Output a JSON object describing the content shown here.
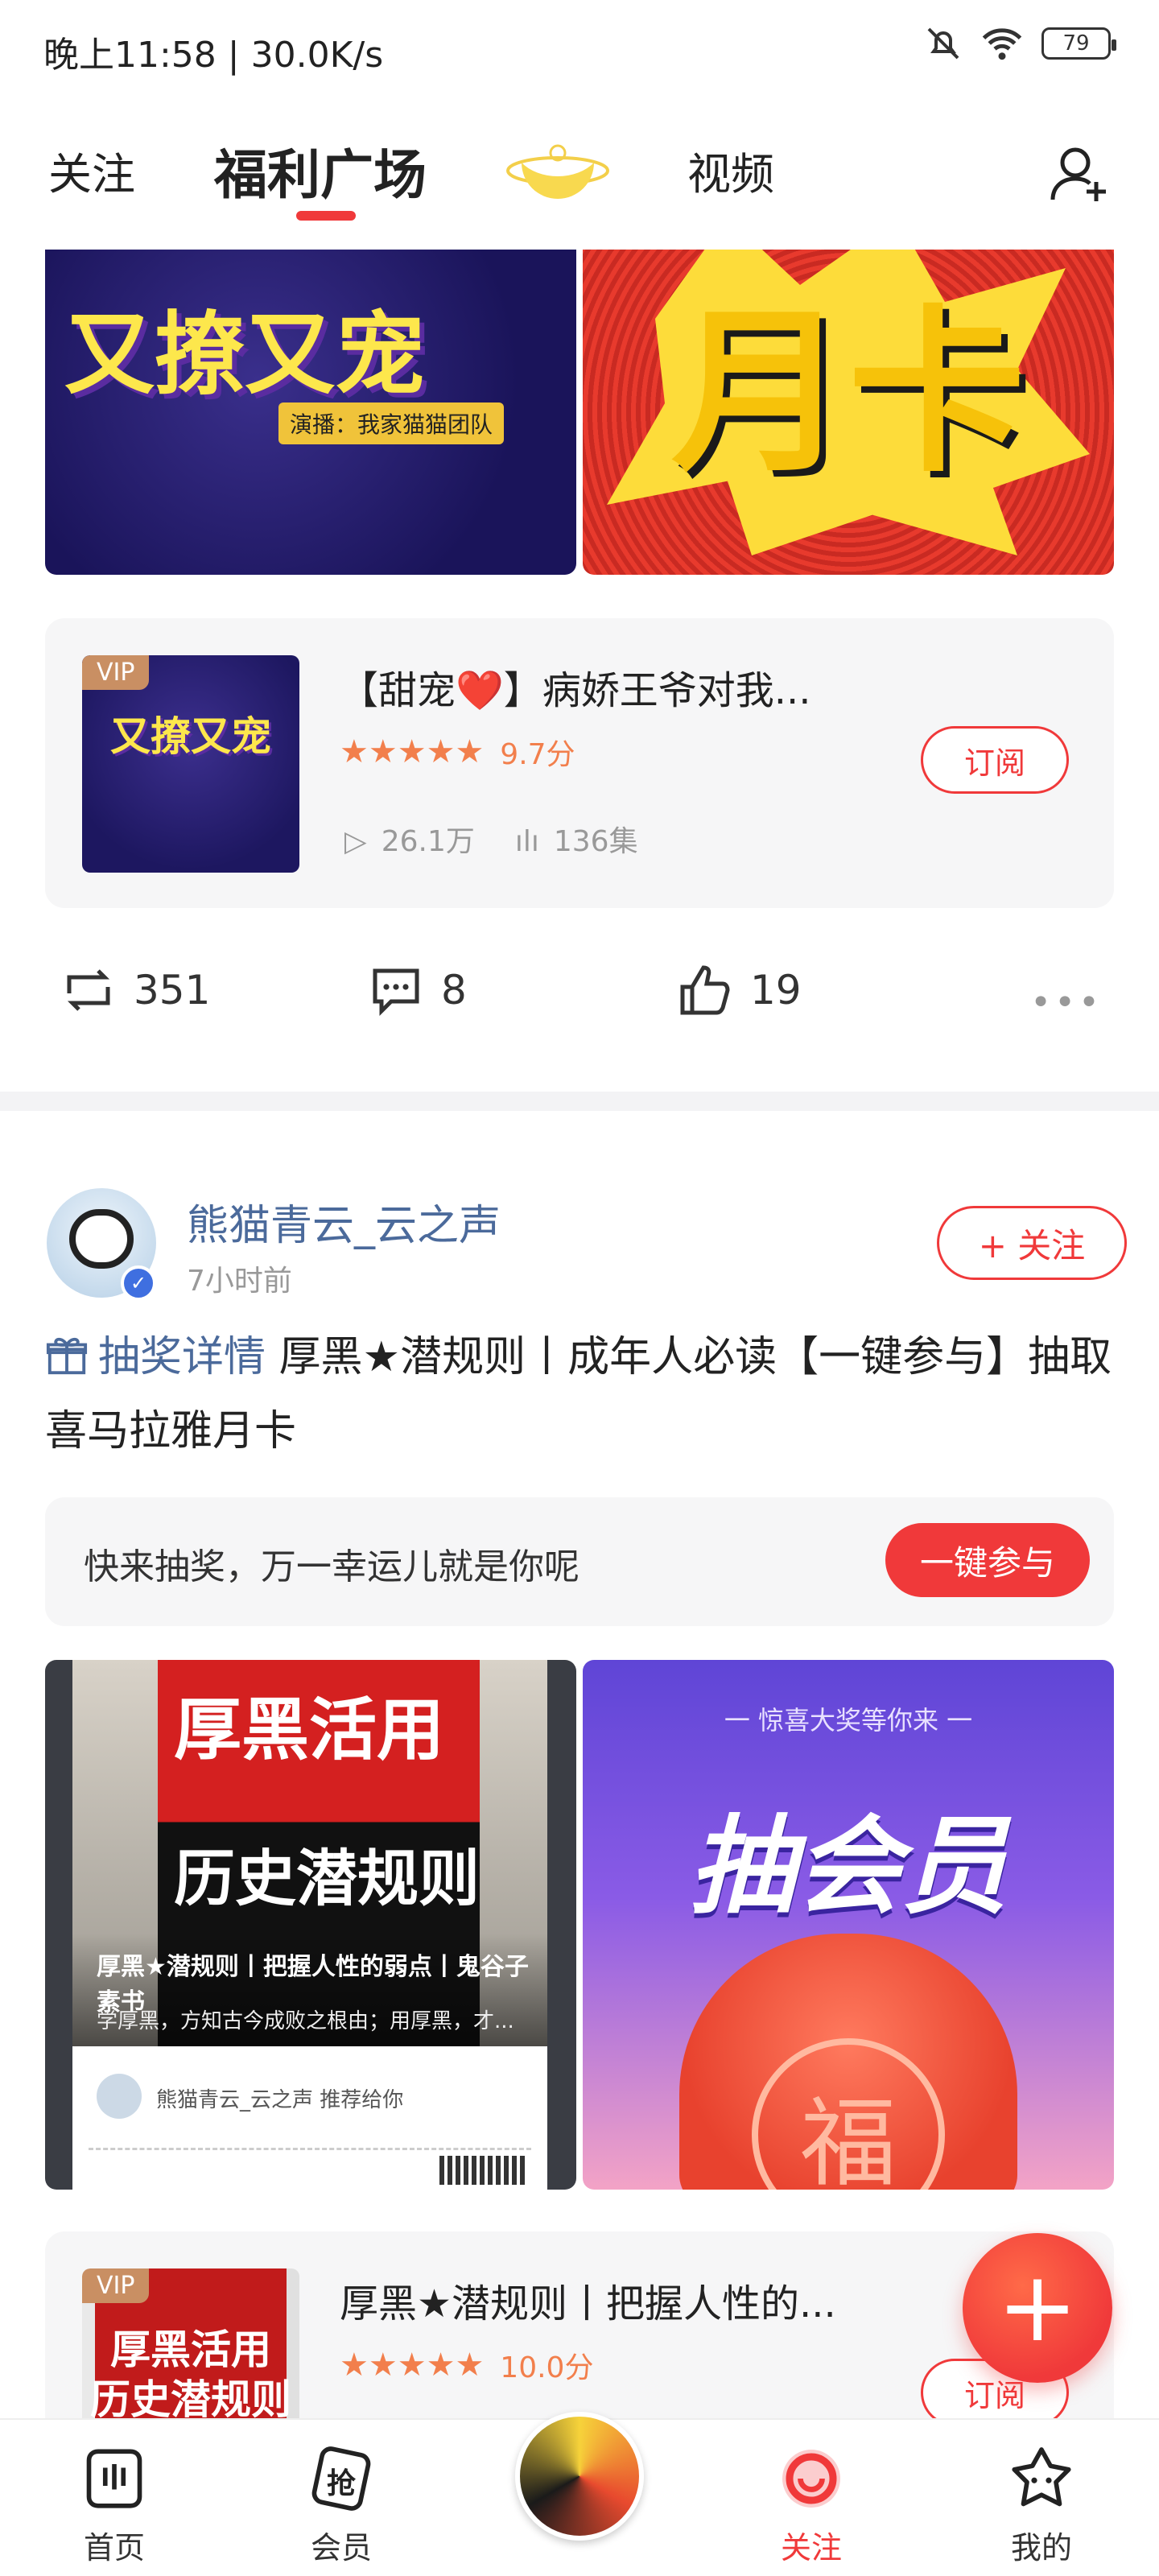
{
  "status_bar": {
    "time": "晚上11:58 | 30.0K/s",
    "battery": "79"
  },
  "top_nav": {
    "tabs": [
      "关注",
      "福利广场",
      "视频"
    ],
    "active_index": 1
  },
  "card1": {
    "vip": "VIP",
    "title": "【甜宠❤️】病娇王爷对我...",
    "rating": "9.7分",
    "plays": "26.1万",
    "episodes": "136集",
    "subscribe": "订阅"
  },
  "actions": {
    "reposts": "351",
    "comments": "8",
    "likes": "19"
  },
  "post": {
    "author": "熊猫青云_云之声",
    "time": "7小时前",
    "follow": "+ 关注",
    "lottery_link": "抽奖详情",
    "text": " 厚黑★潜规则丨成年人必读【一键参与】抽取喜马拉雅月卡",
    "lottery_prompt": "快来抽奖，万一幸运儿就是你呢",
    "join": "一键参与",
    "image1": {
      "title_line1": "厚黑活用",
      "title_line2": "历史潜规则",
      "caption": "厚黑★潜规则丨把握人性的弱点丨鬼谷子 素书",
      "desc": "学厚黑，方知古今成败之根由；用厚黑，才...",
      "recommend": "熊猫青云_云之声 推荐给你"
    },
    "image2": {
      "top": "一 惊喜大奖等你来 一",
      "big": "抽会员",
      "bag": "福"
    }
  },
  "card2": {
    "vip": "VIP",
    "title": "厚黑★潜规则丨把握人性的...",
    "rating": "10.0分",
    "subscribe": "订阅",
    "cover_text": "厚黑活用 历史潜规则"
  },
  "banners": {
    "left_text": "又撩又宠",
    "left_sub": "演播：我家猫猫团队",
    "right_text": "月卡"
  },
  "bottom_nav": {
    "items": [
      "首页",
      "会员",
      "关注",
      "我的"
    ],
    "active": "关注"
  },
  "colors": {
    "accent": "#f0393a",
    "link": "#4b6a9b",
    "star": "#f27f4c"
  }
}
